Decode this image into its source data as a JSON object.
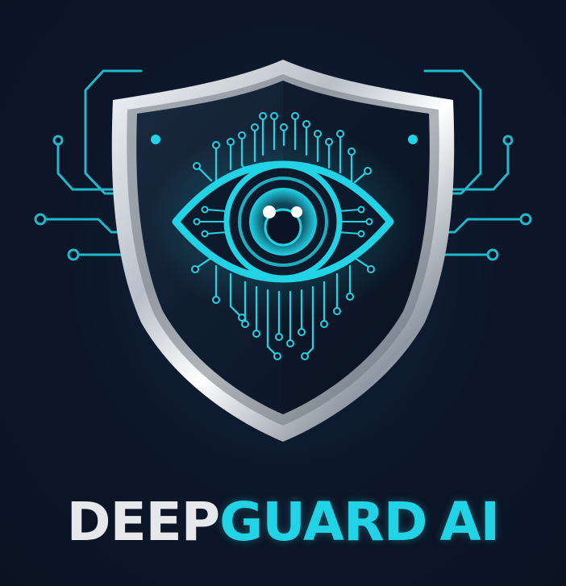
{
  "brand": {
    "word_deep": "DEEP",
    "word_guard": "GUARD",
    "word_ai": "AI",
    "deep_color": "#e6e8ec",
    "accent_color": "#22d3e6",
    "background_color": "#0b1526"
  },
  "emblem": {
    "shape": "shield",
    "icon": "eye-icon",
    "motif": "circuit-traces"
  }
}
